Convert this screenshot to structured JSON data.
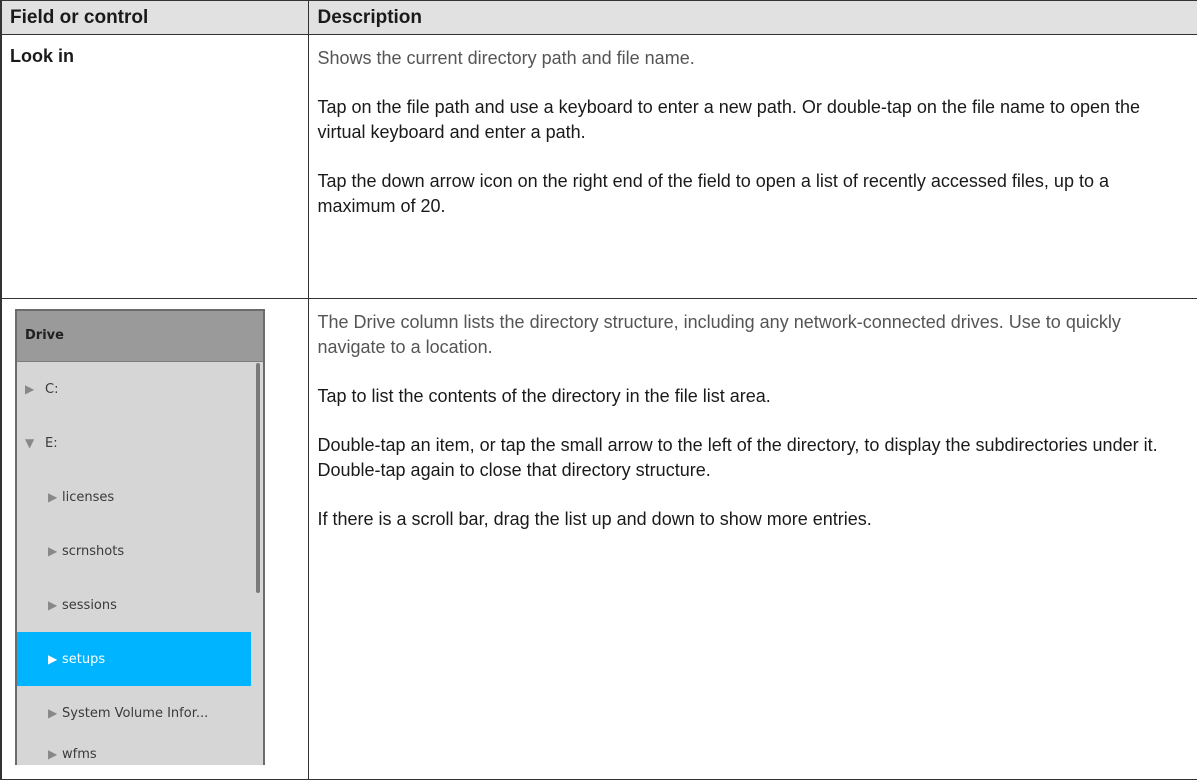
{
  "table": {
    "headers": [
      "Field or control",
      "Description"
    ],
    "rows": [
      {
        "field": "Look in",
        "paragraphs": [
          "Shows the current directory path and file name.",
          "Tap on the file path and use a keyboard to enter a new path. Or double-tap on the file name to open the virtual keyboard and enter a path.",
          "Tap the down arrow icon on the right end of the field to open a list of recently accessed files, up to a maximum of 20."
        ]
      },
      {
        "paragraphs": [
          "The Drive column lists the directory structure, including any network-connected drives. Use to quickly navigate to a location.",
          "Tap to list the contents of the directory in the file list area.",
          "Double-tap an item, or tap the small arrow to the left of the directory, to display the subdirectories under it. Double-tap again to close that directory structure.",
          "If there is a scroll bar, drag the list up and down to show more entries."
        ]
      }
    ]
  },
  "drive_panel": {
    "header": "Drive",
    "items": [
      {
        "label": "C:",
        "arrow": "▶",
        "arrow_name": "collapsed-arrow-icon"
      },
      {
        "label": "E:",
        "arrow": "▼",
        "arrow_name": "expanded-arrow-icon"
      },
      {
        "label": "licenses",
        "arrow": "▶",
        "arrow_name": "collapsed-arrow-icon"
      },
      {
        "label": "scrnshots",
        "arrow": "▶",
        "arrow_name": "collapsed-arrow-icon"
      },
      {
        "label": "sessions",
        "arrow": "▶",
        "arrow_name": "collapsed-arrow-icon"
      },
      {
        "label": "setups",
        "arrow": "▶",
        "arrow_name": "collapsed-arrow-icon",
        "selected": true
      },
      {
        "label": "System Volume Infor...",
        "arrow": "▶",
        "arrow_name": "collapsed-arrow-icon"
      },
      {
        "label": "wfms",
        "arrow": "▶",
        "arrow_name": "collapsed-arrow-icon"
      }
    ],
    "selected_color": "#00b4ff"
  }
}
